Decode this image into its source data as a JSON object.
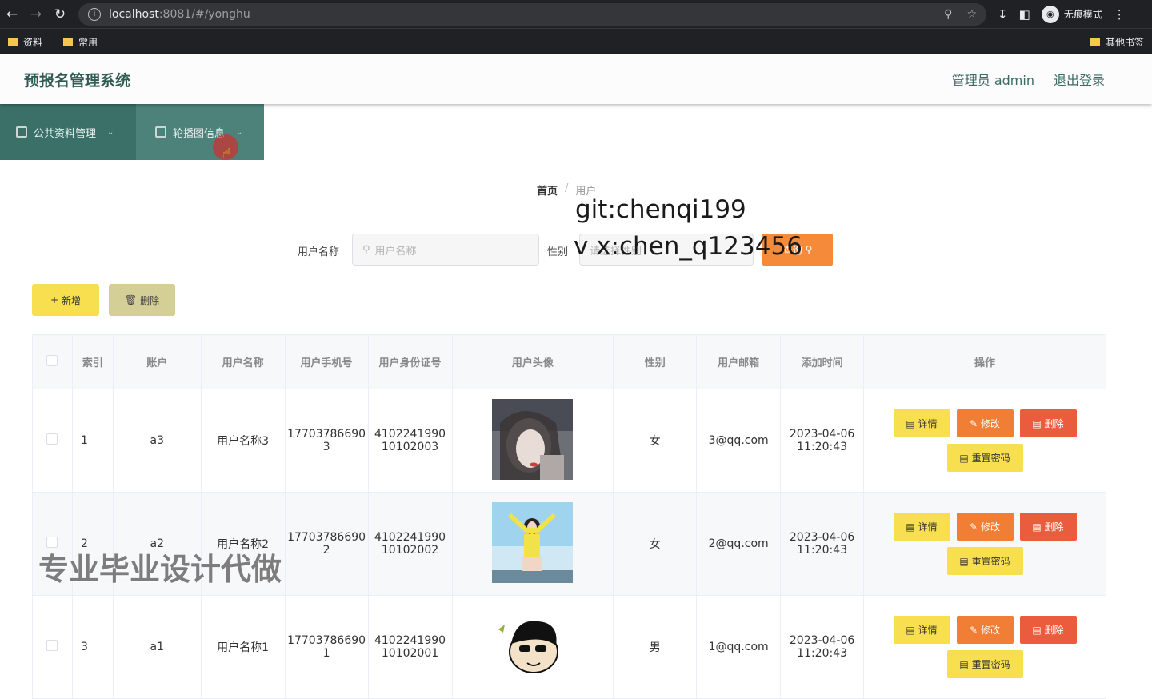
{
  "browser": {
    "url_host": "localhost",
    "url_rest": ":8081/#/yonghu",
    "incognito_label": "无痕模式",
    "bookmarks": [
      "资料",
      "常用"
    ],
    "other_bookmarks": "其他书签"
  },
  "header": {
    "title": "预报名管理系统",
    "user": "管理员 admin",
    "logout": "退出登录"
  },
  "menu": {
    "items": [
      {
        "label": "公共资料管理"
      },
      {
        "label": "轮播图信息"
      }
    ]
  },
  "breadcrumb": {
    "home": "首页",
    "separator": "/",
    "current": "用户"
  },
  "search": {
    "name_label": "用户名称",
    "name_placeholder": "用户名称",
    "gender_label": "性别",
    "gender_placeholder": "请选择性别",
    "query_label": "查询"
  },
  "actions": {
    "add_label": "新增",
    "delete_label": "删除"
  },
  "overlays": {
    "line1": "git:chenqi199",
    "line2": "v x:chen_q123456",
    "line3": "专业毕业设计代做"
  },
  "table": {
    "columns": [
      "索引",
      "账户",
      "用户名称",
      "用户手机号",
      "用户身份证号",
      "用户头像",
      "性别",
      "用户邮箱",
      "添加时间",
      "操作"
    ],
    "rows": [
      {
        "index": "1",
        "account": "a3",
        "name": "用户名称3",
        "phone_1": "17703786690",
        "phone_2": "3",
        "id_1": "4102241990",
        "id_2": "10102003",
        "avatar": "photo-girl-1",
        "gender": "女",
        "email": "3@qq.com",
        "date": "2023-04-06",
        "time": "11:20:43"
      },
      {
        "index": "2",
        "account": "a2",
        "name": "用户名称2",
        "phone_1": "17703786690",
        "phone_2": "2",
        "id_1": "4102241990",
        "id_2": "10102002",
        "avatar": "photo-girl-beach",
        "gender": "女",
        "email": "2@qq.com",
        "date": "2023-04-06",
        "time": "11:20:43"
      },
      {
        "index": "3",
        "account": "a1",
        "name": "用户名称1",
        "phone_1": "17703786690",
        "phone_2": "1",
        "id_1": "4102241990",
        "id_2": "10102001",
        "avatar": "cartoon-boy",
        "gender": "男",
        "email": "1@qq.com",
        "date": "2023-04-06",
        "time": "11:20:43"
      }
    ],
    "ops": {
      "detail": "详情",
      "edit": "修改",
      "delete": "删除",
      "reset": "重置密码"
    }
  }
}
